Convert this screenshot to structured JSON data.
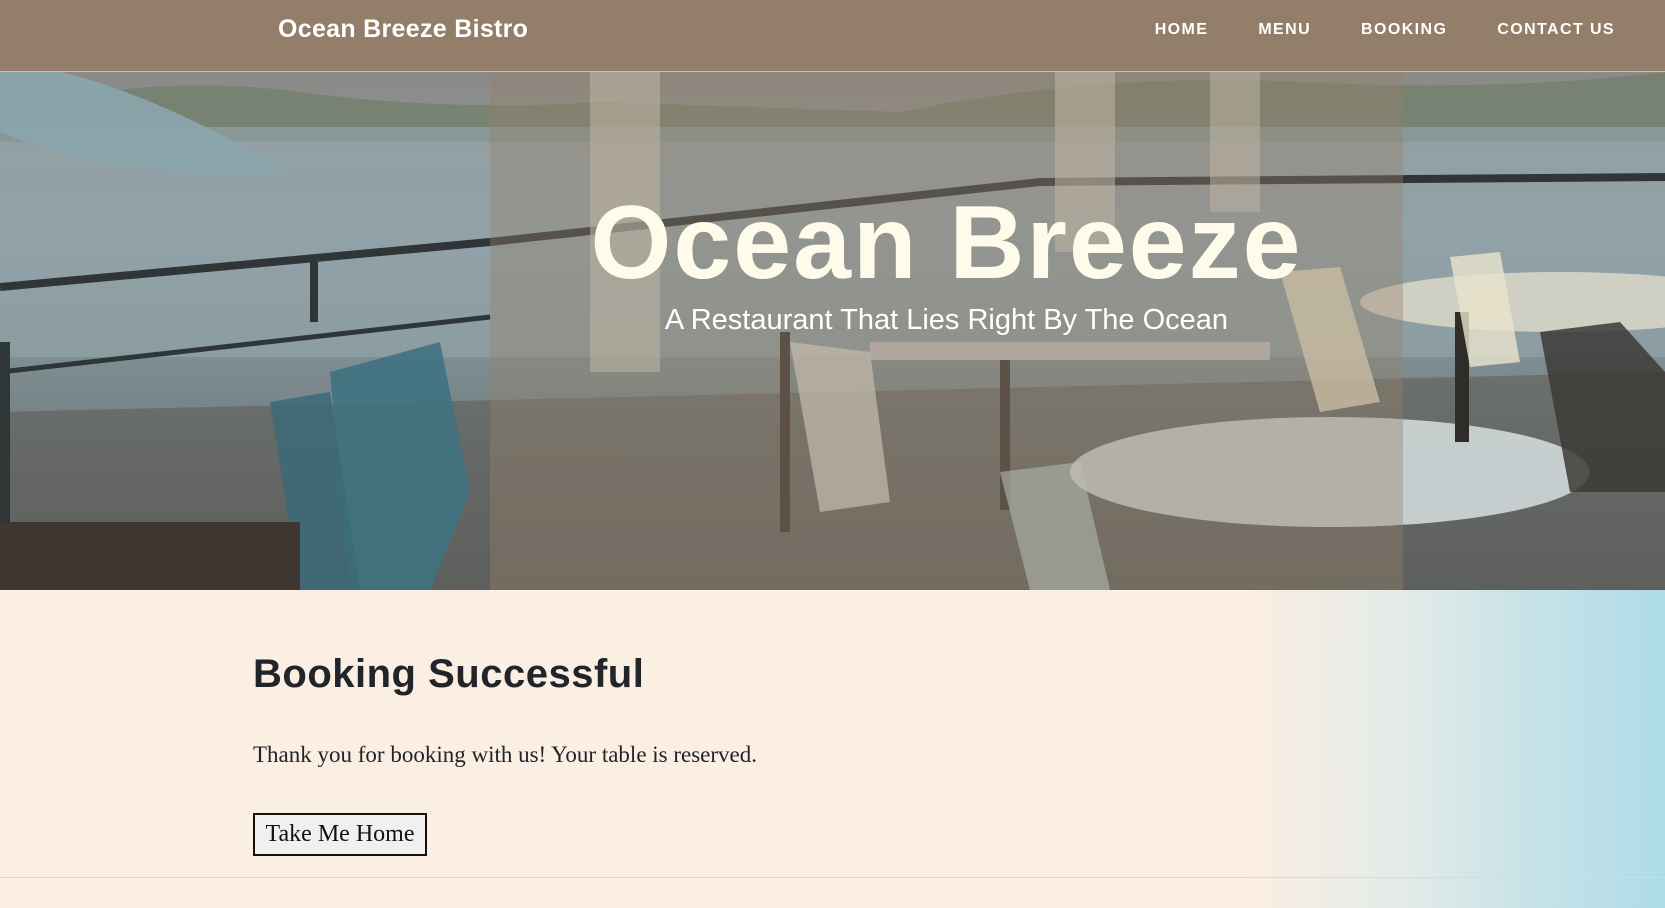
{
  "navbar": {
    "brand": "Ocean Breeze Bistro",
    "links": [
      "HOME",
      "MENU",
      "BOOKING",
      "CONTACT US"
    ]
  },
  "hero": {
    "title": "Ocean Breeze",
    "subtitle": "A Restaurant That Lies Right By The Ocean"
  },
  "main": {
    "heading": "Booking Successful",
    "message": "Thank you for booking with us! Your table is reserved.",
    "home_button_label": "Take Me Home"
  },
  "colors": {
    "navbar_bg": "#937f69",
    "page_bg": "#fbeee2",
    "gradient_end": "#afdbe8",
    "hero_title": "#fffbea",
    "text": "#212529"
  }
}
